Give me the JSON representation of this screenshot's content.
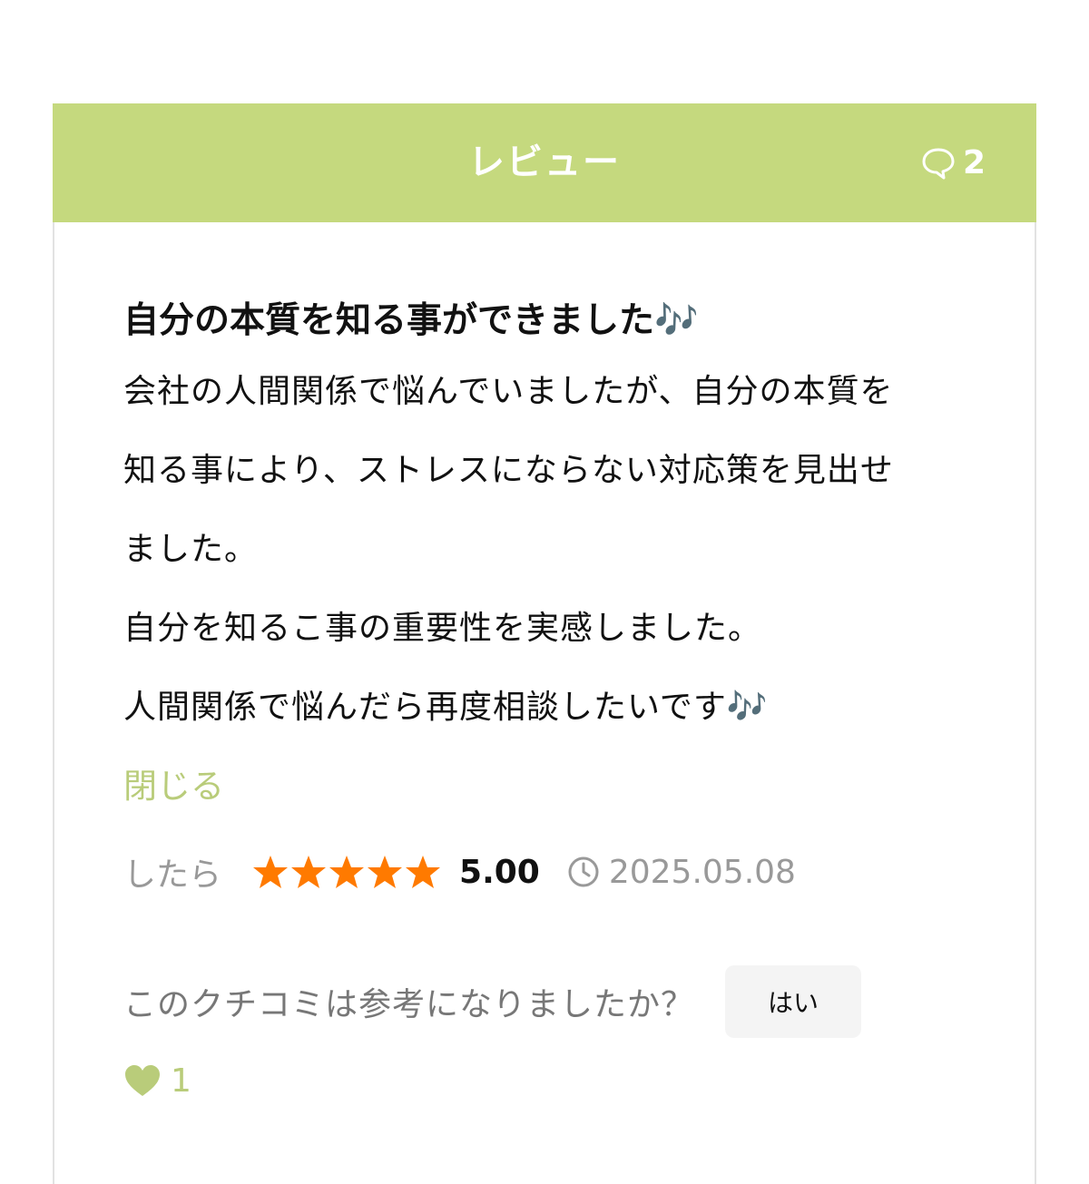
{
  "header": {
    "title": "レビュー",
    "comment_count": "2"
  },
  "review": {
    "title": "自分の本質を知る事ができました🎶",
    "body_lines": [
      "会社の人間関係で悩んでいましたが、自分の本質を",
      "知る事により、ストレスにならない対応策を見出せ",
      "ました。",
      "自分を知るこ事の重要性を実感しました。",
      "人間関係で悩んだら再度相談したいです🎶"
    ],
    "close_label": "閉じる",
    "author": "したら",
    "rating": 5,
    "score": "5.00",
    "date": "2025.05.08"
  },
  "helpful": {
    "question": "このクチコミは参考になりましたか？",
    "yes_label": "はい",
    "like_count": "1"
  },
  "colors": {
    "header_bg": "#c5d97e",
    "accent_green": "#b9cc7a",
    "star": "#ff7a00",
    "muted": "#999999"
  },
  "icons": [
    "comment-icon",
    "star-icon",
    "clock-icon",
    "heart-icon"
  ]
}
